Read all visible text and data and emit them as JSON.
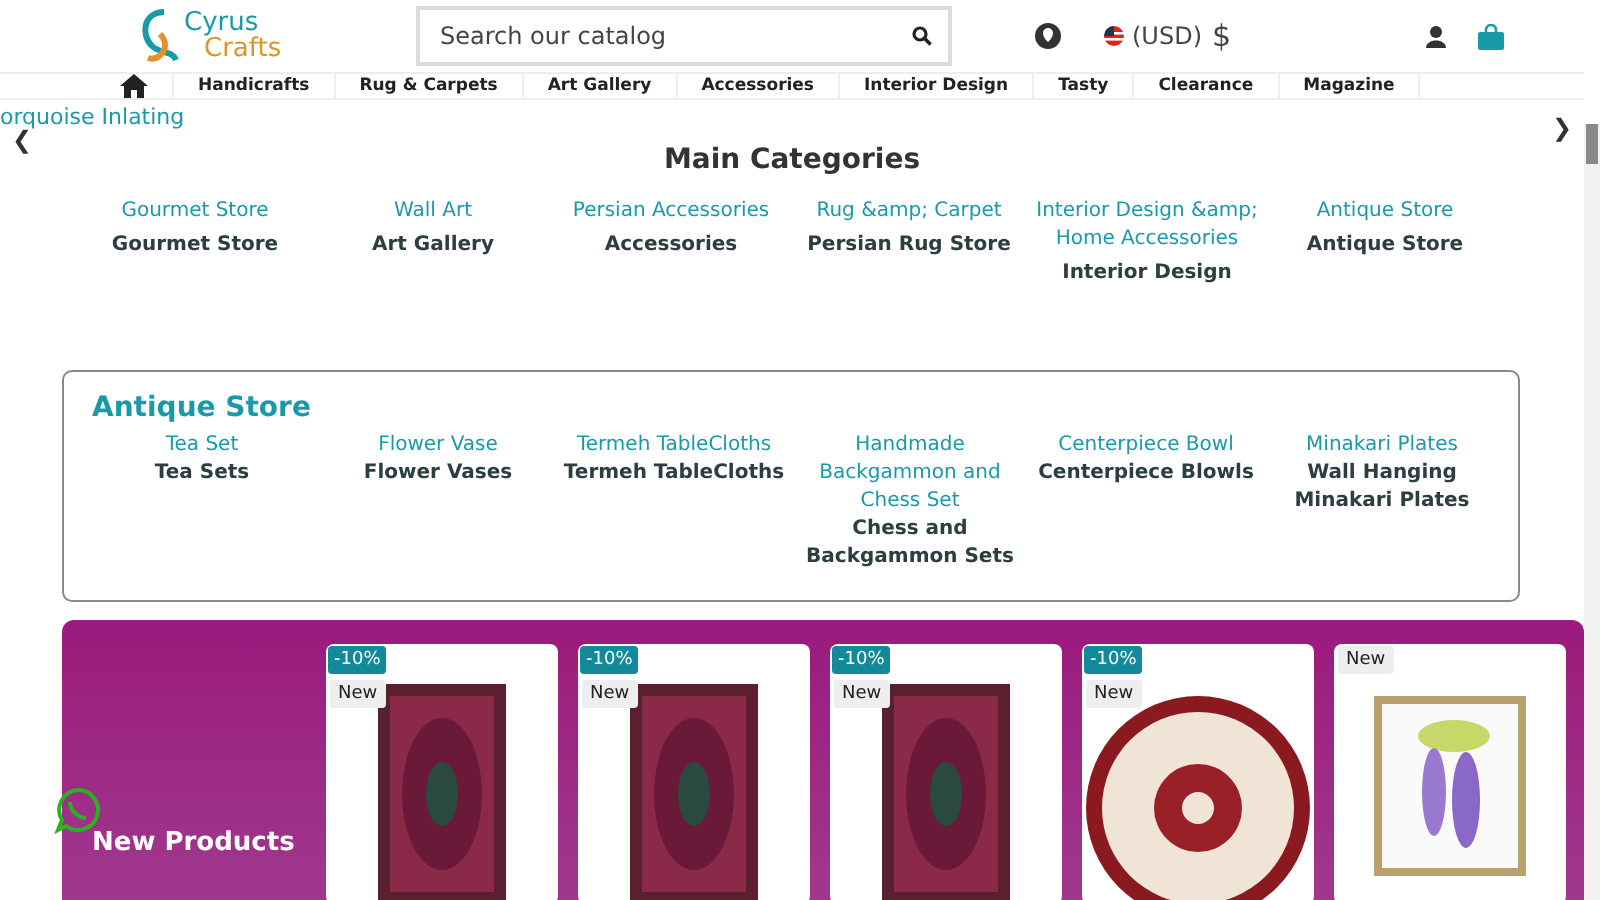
{
  "header": {
    "logo": [
      "Cyrus",
      "Crafts"
    ],
    "search": {
      "placeholder": "Search our catalog"
    },
    "currency": "(USD)",
    "currency_symbol": "$"
  },
  "nav": [
    "Handicrafts",
    "Rug & Carpets",
    "Art Gallery",
    "Accessories",
    "Interior Design",
    "Tasty",
    "Clearance",
    "Magazine"
  ],
  "slider": {
    "caption": "orquoise Inlating",
    "prev": "❮",
    "next": "❯"
  },
  "main_categories": {
    "title": "Main Categories",
    "items": [
      {
        "link": "Gourmet Store",
        "name": "Gourmet Store"
      },
      {
        "link": "Wall Art",
        "name": "Art Gallery"
      },
      {
        "link": "Persian Accessories",
        "name": "Accessories"
      },
      {
        "link": "Rug &amp; Carpet",
        "name": "Persian Rug Store"
      },
      {
        "link": "Interior Design &amp; Home Accessories",
        "name": "Interior Design"
      },
      {
        "link": "Antique Store",
        "name": "Antique Store"
      }
    ]
  },
  "antique_store": {
    "title": "Antique Store",
    "items": [
      {
        "link": "Tea Set",
        "name": "Tea Sets"
      },
      {
        "link": "Flower Vase",
        "name": "Flower Vases"
      },
      {
        "link": "Termeh TableCloths",
        "name": "Termeh TableCloths"
      },
      {
        "link": "Handmade Backgammon and Chess Set",
        "name": "Chess and Backgammon Sets"
      },
      {
        "link": "Centerpiece Bowl",
        "name": "Centerpiece Blowls"
      },
      {
        "link": "Minakari Plates",
        "name": "Wall Hanging Minakari Plates"
      }
    ]
  },
  "new_products": {
    "title": "New Products",
    "products": [
      {
        "discount": "-10%",
        "badge": "New",
        "kind": "rug"
      },
      {
        "discount": "-10%",
        "badge": "New",
        "kind": "rug"
      },
      {
        "discount": "-10%",
        "badge": "New",
        "kind": "rug"
      },
      {
        "discount": "-10%",
        "badge": "New",
        "kind": "round-rug"
      },
      {
        "badge": "New",
        "kind": "painting"
      }
    ]
  }
}
